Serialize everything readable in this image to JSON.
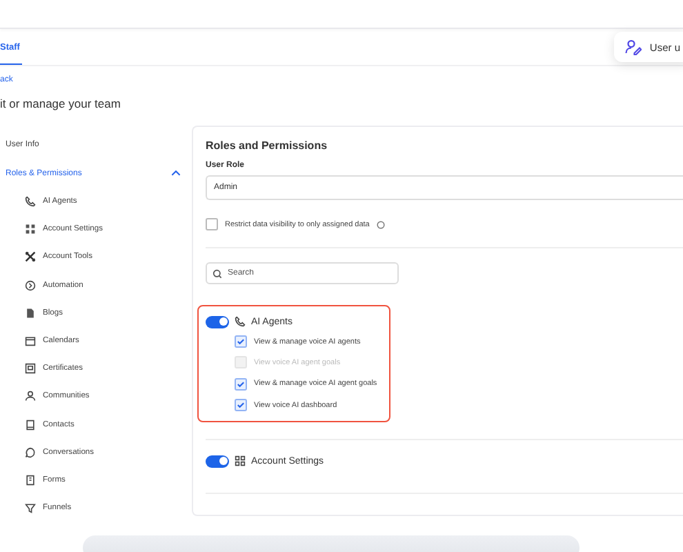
{
  "tabs": [
    {
      "label": "Staff",
      "selected": true
    }
  ],
  "user_popup": {
    "label": "User u"
  },
  "back_link": "ack",
  "page_title": "it or manage your team",
  "sidebar": {
    "items": [
      {
        "label": "User Info",
        "selected": false
      },
      {
        "label": "Roles & Permissions",
        "selected": true,
        "expanded": true,
        "children": [
          {
            "label": "AI Agents"
          },
          {
            "label": "Account Settings"
          },
          {
            "label": "Account Tools"
          },
          {
            "label": "Automation"
          },
          {
            "label": "Blogs"
          },
          {
            "label": "Calendars"
          },
          {
            "label": "Certificates"
          },
          {
            "label": "Communities"
          },
          {
            "label": "Contacts"
          },
          {
            "label": "Conversations"
          },
          {
            "label": "Forms"
          },
          {
            "label": "Funnels"
          }
        ]
      }
    ]
  },
  "panel": {
    "title": "Roles and Permissions",
    "user_role": {
      "label": "User Role",
      "value": "Admin"
    },
    "restrict": {
      "label": "Restrict data visibility to only assigned data",
      "checked": false
    },
    "search": {
      "placeholder": "Search"
    },
    "groups": [
      {
        "label": "AI Agents",
        "on": true,
        "highlighted": true,
        "permissions": [
          {
            "label": "View & manage voice AI agents",
            "checked": true,
            "disabled": false
          },
          {
            "label": "View voice AI agent goals",
            "checked": false,
            "disabled": true
          },
          {
            "label": "View & manage voice AI agent goals",
            "checked": true,
            "disabled": false
          },
          {
            "label": "View voice AI dashboard",
            "checked": true,
            "disabled": false
          }
        ]
      },
      {
        "label": "Account Settings",
        "on": true
      }
    ]
  }
}
